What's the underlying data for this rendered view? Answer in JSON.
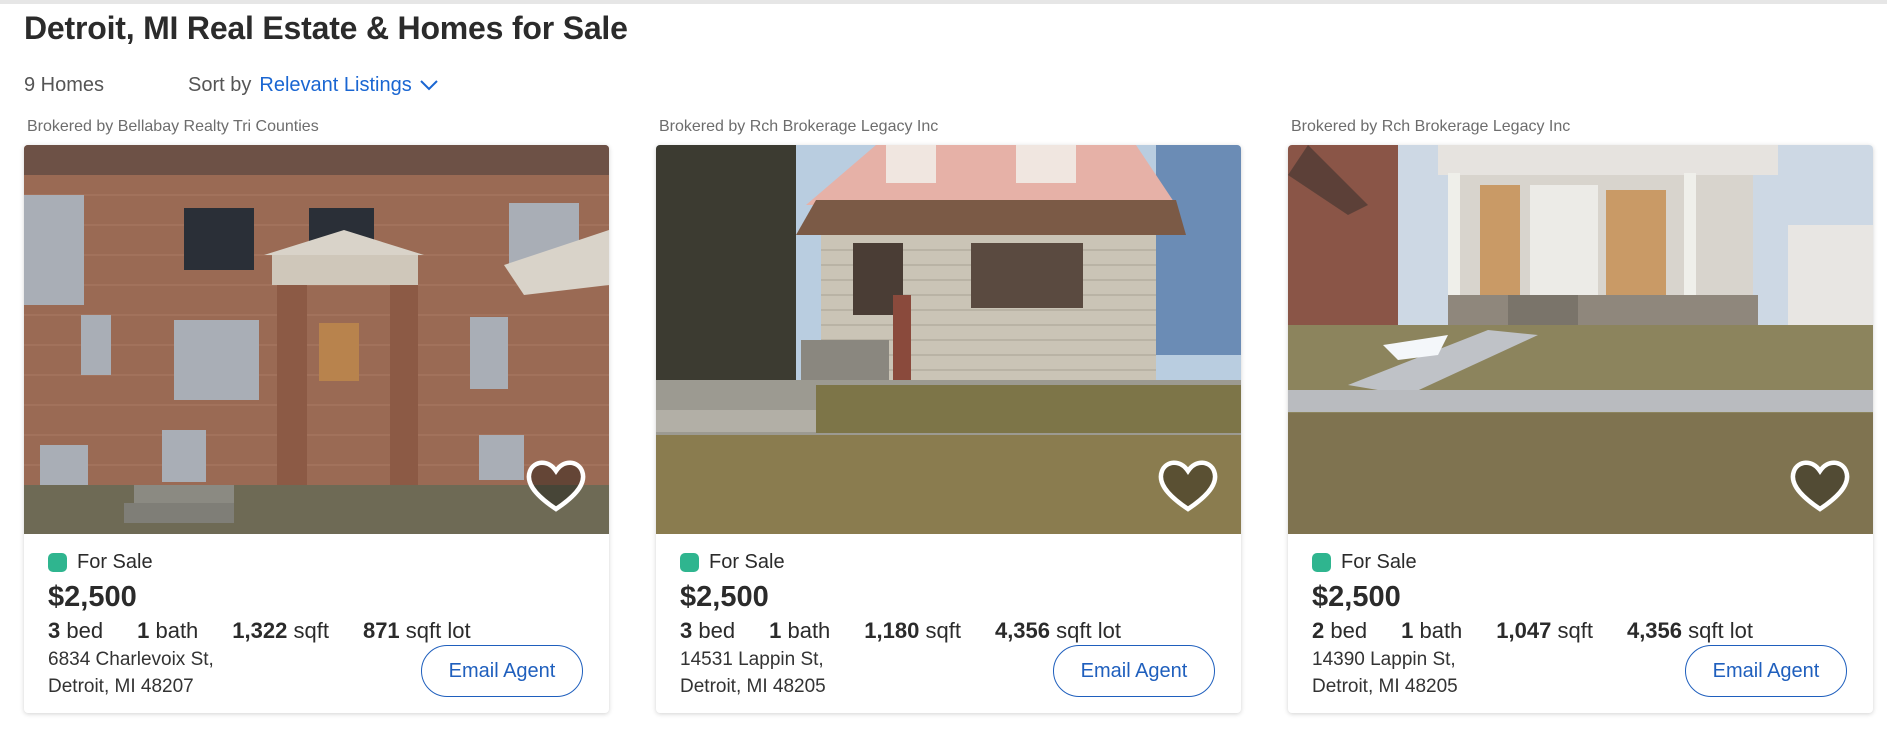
{
  "page": {
    "title": "Detroit, MI Real Estate & Homes for Sale",
    "count": "9 Homes",
    "sort_label": "Sort by",
    "sort_value": "Relevant Listings"
  },
  "colors": {
    "accent": "#1a66d2",
    "status_green": "#2fb58f",
    "text": "#2b2b2b"
  },
  "listings": [
    {
      "broker": "Brokered by Bellabay Realty Tri Counties",
      "status": "For Sale",
      "price": "$2,500",
      "beds": "3",
      "beds_label": "bed",
      "baths": "1",
      "baths_label": "bath",
      "sqft": "1,322",
      "sqft_label": "sqft",
      "lot": "871",
      "lot_label": "sqft lot",
      "address_line1": "6834 Charlevoix St,",
      "address_line2": "Detroit, MI 48207",
      "cta": "Email Agent"
    },
    {
      "broker": "Brokered by Rch Brokerage Legacy Inc",
      "status": "For Sale",
      "price": "$2,500",
      "beds": "3",
      "beds_label": "bed",
      "baths": "1",
      "baths_label": "bath",
      "sqft": "1,180",
      "sqft_label": "sqft",
      "lot": "4,356",
      "lot_label": "sqft lot",
      "address_line1": "14531 Lappin St,",
      "address_line2": "Detroit, MI 48205",
      "cta": "Email Agent"
    },
    {
      "broker": "Brokered by Rch Brokerage Legacy Inc",
      "status": "For Sale",
      "price": "$2,500",
      "beds": "2",
      "beds_label": "bed",
      "baths": "1",
      "baths_label": "bath",
      "sqft": "1,047",
      "sqft_label": "sqft",
      "lot": "4,356",
      "lot_label": "sqft lot",
      "address_line1": "14390 Lappin St,",
      "address_line2": "Detroit, MI 48205",
      "cta": "Email Agent"
    }
  ]
}
